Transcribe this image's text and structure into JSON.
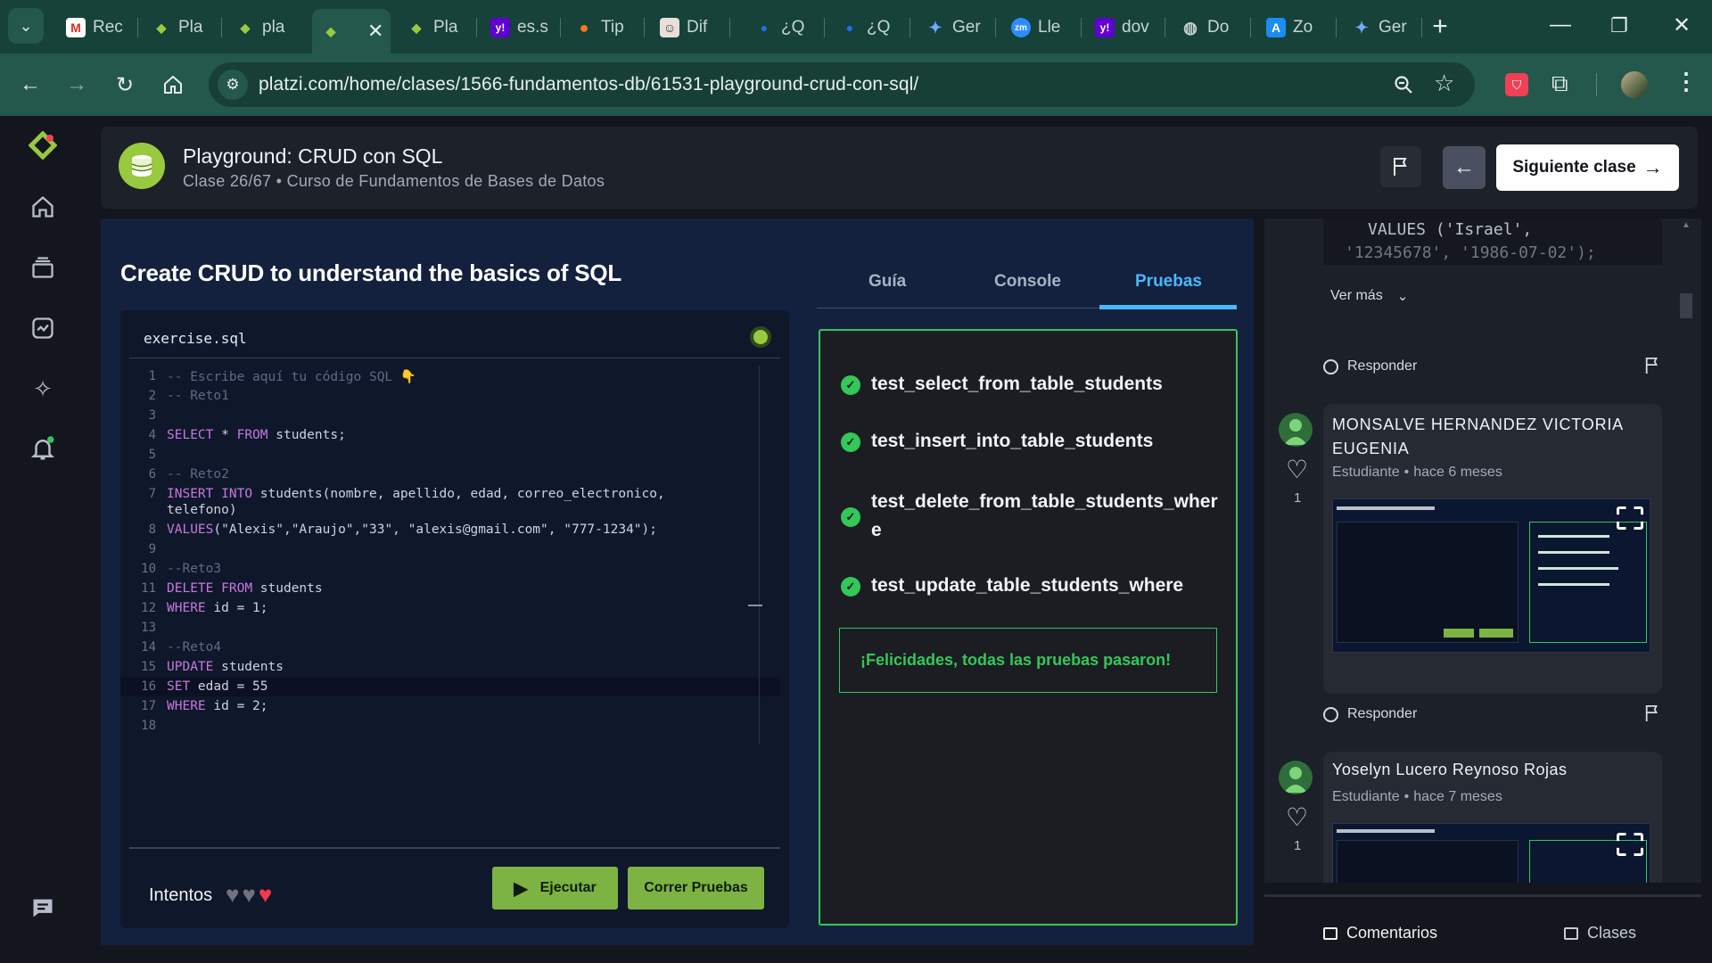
{
  "browser": {
    "tabs": [
      {
        "title": "Rec",
        "icon": "gmail-icon"
      },
      {
        "title": "Pla",
        "icon": "platzi-icon"
      },
      {
        "title": "pla",
        "icon": "platzi-icon"
      },
      {
        "title": "",
        "icon": "platzi-icon",
        "active": true
      },
      {
        "title": "Pla",
        "icon": "platzi-icon"
      },
      {
        "title": "es.s",
        "icon": "yahoo-icon"
      },
      {
        "title": "Tip",
        "icon": "fire-icon"
      },
      {
        "title": "Dif",
        "icon": "profile-icon"
      },
      {
        "title": "¿Q",
        "icon": "dot-icon"
      },
      {
        "title": "¿Q",
        "icon": "dot-icon"
      },
      {
        "title": "Ger",
        "icon": "gemini-icon"
      },
      {
        "title": "Lle",
        "icon": "zoom-icon"
      },
      {
        "title": "dov",
        "icon": "yahoo-icon"
      },
      {
        "title": "Do",
        "icon": "globe-icon"
      },
      {
        "title": "Zo",
        "icon": "appstore-icon"
      },
      {
        "title": "Ger",
        "icon": "gemini-icon"
      }
    ],
    "url": "platzi.com/home/clases/1566-fundamentos-db/61531-playground-crud-con-sql/"
  },
  "lesson": {
    "title": "Playground: CRUD con SQL",
    "subtitle": "Clase 26/67 • Curso de Fundamentos de Bases de Datos",
    "next_label": "Siguiente clase"
  },
  "playground": {
    "heading": "Create CRUD to understand the basics of SQL",
    "filename": "exercise.sql",
    "code": [
      "-- Escribe aquí tu código SQL 👇",
      "-- Reto1",
      "",
      "SELECT * FROM students;",
      "",
      "-- Reto2",
      "INSERT INTO students(nombre, apellido, edad, correo_electronico,",
      "VALUES(\"Alexis\",\"Araujo\",\"33\", \"alexis@gmail.com\", \"777-1234\");",
      "",
      "--Reto3",
      "DELETE FROM students",
      "WHERE id = 1;",
      "",
      "--Reto4",
      "UPDATE students",
      "SET edad = 55",
      "WHERE id = 2;",
      ""
    ],
    "code_wrap_line7": "telefono)",
    "attempts_label": "Intentos",
    "run_label": "Ejecutar",
    "test_label": "Correr Pruebas"
  },
  "results": {
    "tabs": [
      "Guía",
      "Console",
      "Pruebas"
    ],
    "active_tab": "Pruebas",
    "tests": [
      "test_select_from_table_students",
      "test_insert_into_table_students",
      "test_delete_from_table_students_wher",
      "test_update_table_students_where"
    ],
    "test3_wrap": "e",
    "success_message": "¡Felicidades, todas las pruebas pasaron!"
  },
  "comments": {
    "snippet_line1": "VALUES ('Israel',",
    "snippet_line2": "'12345678', '1986-07-02');",
    "see_more": "Ver más",
    "reply": "Responder",
    "items": [
      {
        "name": "MONSALVE HERNANDEZ VICTORIA EUGENIA",
        "role": "Estudiante",
        "time": "hace 6 meses",
        "likes": "1"
      },
      {
        "name": "Yoselyn Lucero Reynoso Rojas",
        "role": "Estudiante",
        "time": "hace 7 meses",
        "likes": "1"
      }
    ],
    "footer_comments": "Comentarios",
    "footer_classes": "Clases"
  },
  "colors": {
    "accent_green": "#98ca3f",
    "success_green": "#34c759",
    "browser_frame": "#16423a",
    "panel_blue": "#13213e"
  }
}
